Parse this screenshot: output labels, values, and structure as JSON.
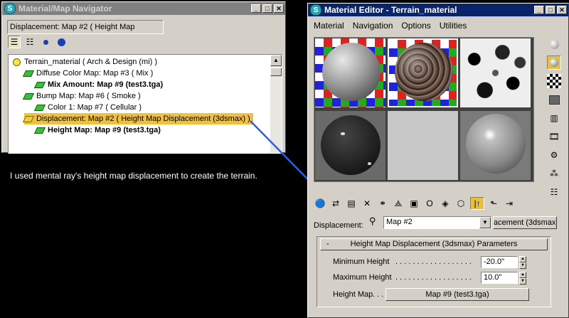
{
  "navigator": {
    "title": "Material/Map Navigator",
    "path": "Displacement: Map #2  ( Height Map",
    "tree": [
      {
        "text": "Terrain_material  ( Arch & Design (mi) )",
        "icon": "material"
      },
      {
        "text": "Diffuse Color Map: Map #3  ( Mix )",
        "icon": "map"
      },
      {
        "text": "Mix Amount: Map #9 (test3.tga)",
        "icon": "map"
      },
      {
        "text": "Bump Map: Map #6  ( Smoke )",
        "icon": "map"
      },
      {
        "text": "Color 1: Map #7  ( Cellular )",
        "icon": "map"
      },
      {
        "text": "Displacement: Map #2  ( Height Map Displacement (3dsmax) )",
        "icon": "map-selected"
      },
      {
        "text": "Height Map:  Map #9 (test3.tga)",
        "icon": "map"
      }
    ]
  },
  "caption": "I used mental ray's height map displacement to create the terrain.",
  "editor": {
    "title": "Material Editor - Terrain_material",
    "menu": [
      "Material",
      "Navigation",
      "Options",
      "Utilities"
    ],
    "displacement_label": "Displacement:",
    "map_name": "Map #2",
    "type_button": "acement (3dsmax)",
    "rollout_toggle": "-",
    "rollout_title": "Height Map Displacement (3dsmax) Parameters",
    "min_height_label": "Minimum Height",
    "min_height_value": "-20.0\"",
    "max_height_label": "Maximum Height",
    "max_height_value": "10.0\"",
    "height_map_label": "Height Map",
    "height_map_button": "Map #9 (test3.tga)",
    "dots": ". . . . . . . . . . . . . . . . . . . . . . . . . . .",
    "dots_short": ". . ."
  }
}
